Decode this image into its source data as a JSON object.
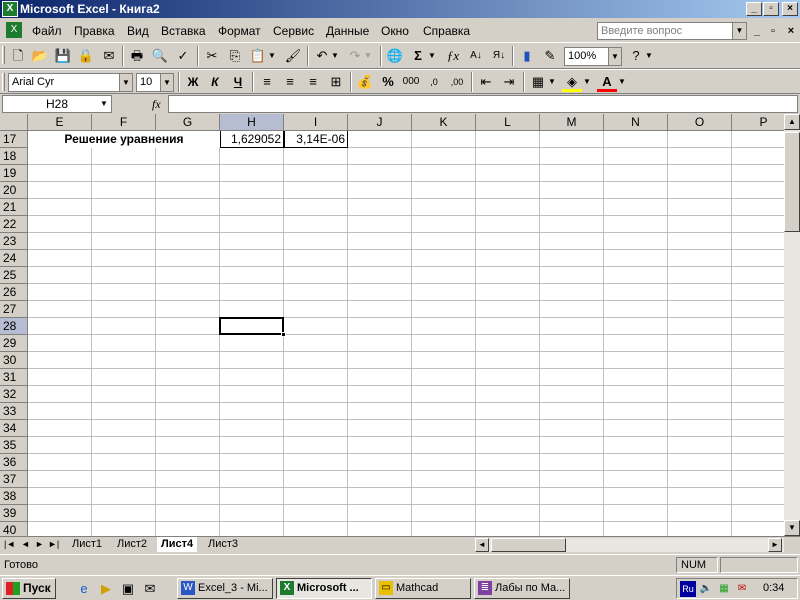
{
  "window": {
    "title": "Microsoft Excel - Книга2",
    "app_icon": "excel-icon",
    "controls": [
      "minimize",
      "restore",
      "close"
    ]
  },
  "menu": {
    "items": [
      "Файл",
      "Правка",
      "Вид",
      "Вставка",
      "Формат",
      "Сервис",
      "Данные",
      "Окно",
      "Справка"
    ],
    "help_placeholder": "Введите вопрос"
  },
  "standard_toolbar": {
    "buttons": [
      "new-icon",
      "open-icon",
      "save-icon",
      "permission-icon",
      "email-icon",
      "print-icon",
      "print-preview-icon",
      "spelling-icon",
      "cut-icon",
      "copy-icon",
      "paste-icon",
      "format-painter-icon",
      "undo-icon",
      "redo-icon",
      "hyperlink-icon",
      "autosum-icon",
      "function-icon",
      "sort-asc-icon",
      "sort-desc-icon",
      "chart-icon",
      "drawing-icon",
      "help-icon"
    ],
    "zoom": "100%"
  },
  "format_toolbar": {
    "font": "Arial Cyr",
    "size": "10",
    "bold": "Ж",
    "italic": "К",
    "underline": "Ч",
    "percent": "%",
    "thousands": "000"
  },
  "formula_bar": {
    "name_box": "H28",
    "fx": "fx",
    "formula": ""
  },
  "sheet": {
    "columns": [
      "E",
      "F",
      "G",
      "H",
      "I",
      "J",
      "K",
      "L",
      "M",
      "N",
      "O",
      "P"
    ],
    "rows": [
      "17",
      "18",
      "19",
      "20",
      "21",
      "22",
      "23",
      "24",
      "25",
      "26",
      "27",
      "28",
      "29",
      "30",
      "31",
      "32",
      "33",
      "34",
      "35",
      "36",
      "37",
      "38",
      "39",
      "40"
    ],
    "active_cell": "H28",
    "cells": {
      "E17": "Решение уравнения",
      "H17": "1,629052",
      "I17": "3,14E-06"
    }
  },
  "tabs": {
    "sheets": [
      "Лист1",
      "Лист2",
      "Лист4",
      "Лист3"
    ],
    "active": "Лист4"
  },
  "status": {
    "ready": "Готово",
    "num": "NUM"
  },
  "taskbar": {
    "start": "Пуск",
    "tasks": [
      "Excel_3 - Mi...",
      "Microsoft ...",
      "Mathcad",
      "Лабы по Ма..."
    ],
    "active_task": "Microsoft ...",
    "lang": "Ru",
    "clock": "0:34"
  }
}
